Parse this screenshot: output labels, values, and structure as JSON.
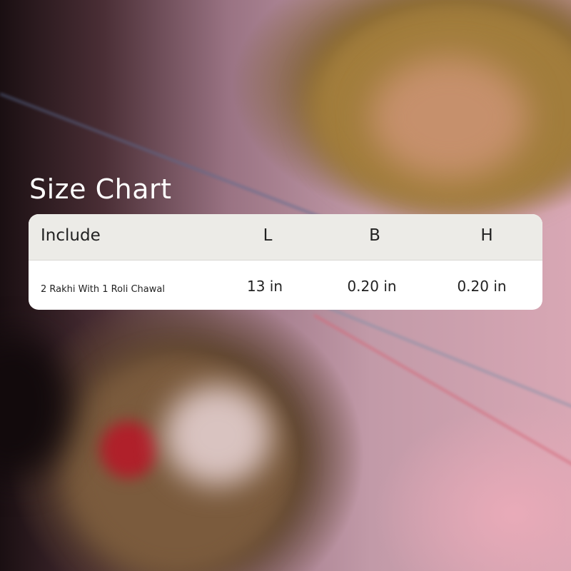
{
  "title": "Size Chart",
  "table": {
    "columns": [
      "Include",
      "L",
      "B",
      "H"
    ],
    "rows": [
      {
        "include": "2 Rakhi With 1 Roli Chawal",
        "l": "13 in",
        "b": "0.20 in",
        "h": "0.20 in"
      }
    ]
  },
  "colors": {
    "header_bg": "#ecebe7",
    "card_bg": "#ffffff",
    "title_text": "#ffffff",
    "table_text": "#222222"
  }
}
